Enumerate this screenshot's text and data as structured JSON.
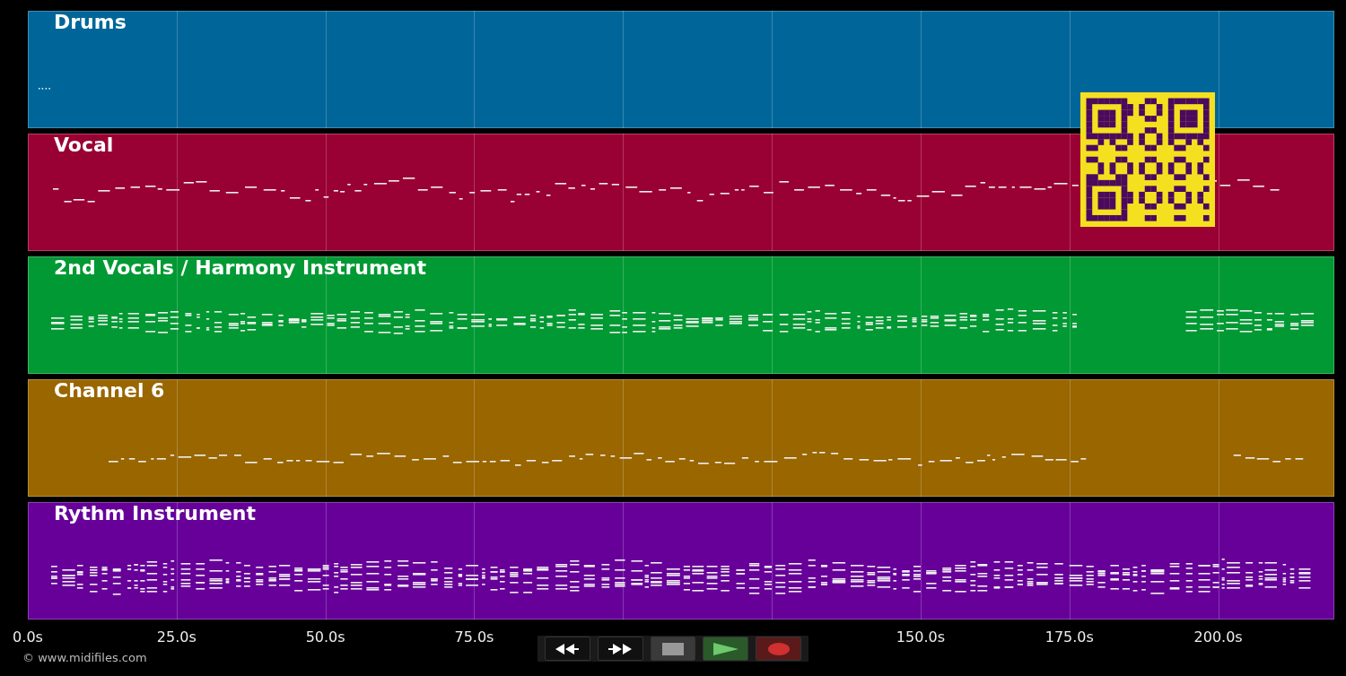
{
  "tracks": [
    {
      "name": "Drums",
      "color": "#006699"
    },
    {
      "name": "Vocal",
      "color": "#990033"
    },
    {
      "name": "2nd Vocals / Harmony Instrument",
      "color": "#009933"
    },
    {
      "name": "Channel 6",
      "color": "#996600"
    },
    {
      "name": "Rythm Instrument",
      "color": "#660099"
    }
  ],
  "time_axis": [
    "0.0s",
    "25.0s",
    "50.0s",
    "75.0s",
    "150.0s",
    "175.0s",
    "200.0s"
  ],
  "copyright": "© www.midifiles.com"
}
